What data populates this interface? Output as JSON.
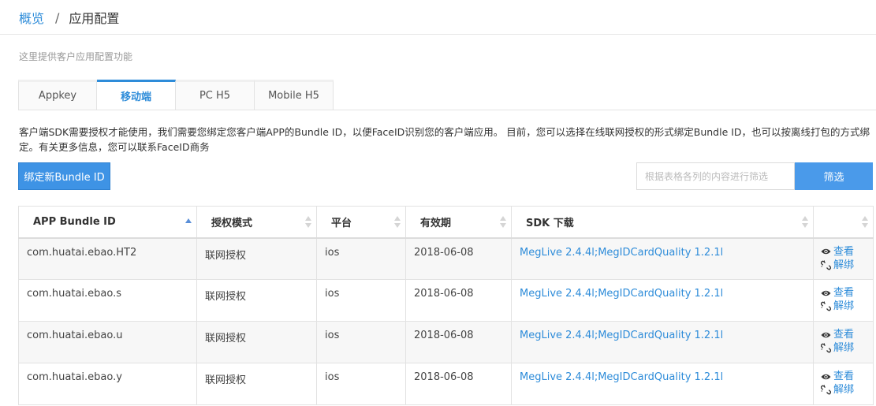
{
  "breadcrumb": {
    "root": "概览",
    "separator": "/",
    "current": "应用配置"
  },
  "intro": "这里提供客户应用配置功能",
  "tabs": [
    {
      "label": "Appkey",
      "active": false
    },
    {
      "label": "移动端",
      "active": true
    },
    {
      "label": "PC H5",
      "active": false
    },
    {
      "label": "Mobile H5",
      "active": false
    }
  ],
  "description": "客户端SDK需要授权才能使用，我们需要您绑定您客户端APP的Bundle ID，以便FaceID识别您的客户端应用。 目前，您可以选择在线联网授权的形式绑定Bundle ID，也可以按离线打包的方式绑定。有关更多信息，您可以联系FaceID商务",
  "toolbar": {
    "bind_button": "绑定新Bundle ID",
    "filter_placeholder": "根据表格各列的内容进行筛选",
    "filter_value": "",
    "filter_button": "筛选"
  },
  "table": {
    "headers": [
      "APP Bundle ID",
      "授权模式",
      "平台",
      "有效期",
      "SDK 下载",
      ""
    ],
    "sort_column": "APP Bundle ID",
    "sort_direction": "ascending",
    "rows": [
      {
        "bundle_id": "com.huatai.ebao.HT2",
        "auth_mode": "联网授权",
        "platform": "ios",
        "expiry": "2018-06-08",
        "sdk": "MegLive 2.4.4l;MegIDCardQuality 1.2.1l",
        "view": "查看",
        "unbind": "解绑"
      },
      {
        "bundle_id": "com.huatai.ebao.s",
        "auth_mode": "联网授权",
        "platform": "ios",
        "expiry": "2018-06-08",
        "sdk": "MegLive 2.4.4l;MegIDCardQuality 1.2.1l",
        "view": "查看",
        "unbind": "解绑"
      },
      {
        "bundle_id": "com.huatai.ebao.u",
        "auth_mode": "联网授权",
        "platform": "ios",
        "expiry": "2018-06-08",
        "sdk": "MegLive 2.4.4l;MegIDCardQuality 1.2.1l",
        "view": "查看",
        "unbind": "解绑"
      },
      {
        "bundle_id": "com.huatai.ebao.y",
        "auth_mode": "联网授权",
        "platform": "ios",
        "expiry": "2018-06-08",
        "sdk": "MegLive 2.4.4l;MegIDCardQuality 1.2.1l",
        "view": "查看",
        "unbind": "解绑"
      }
    ]
  },
  "icons": {
    "view": "eye-icon",
    "unbind": "unlink-icon",
    "sort": "sort-arrows-icon"
  },
  "colors": {
    "accent": "#2e8cd9",
    "primary_button": "#3e93e5",
    "row_stripe": "#f7f7f7"
  }
}
